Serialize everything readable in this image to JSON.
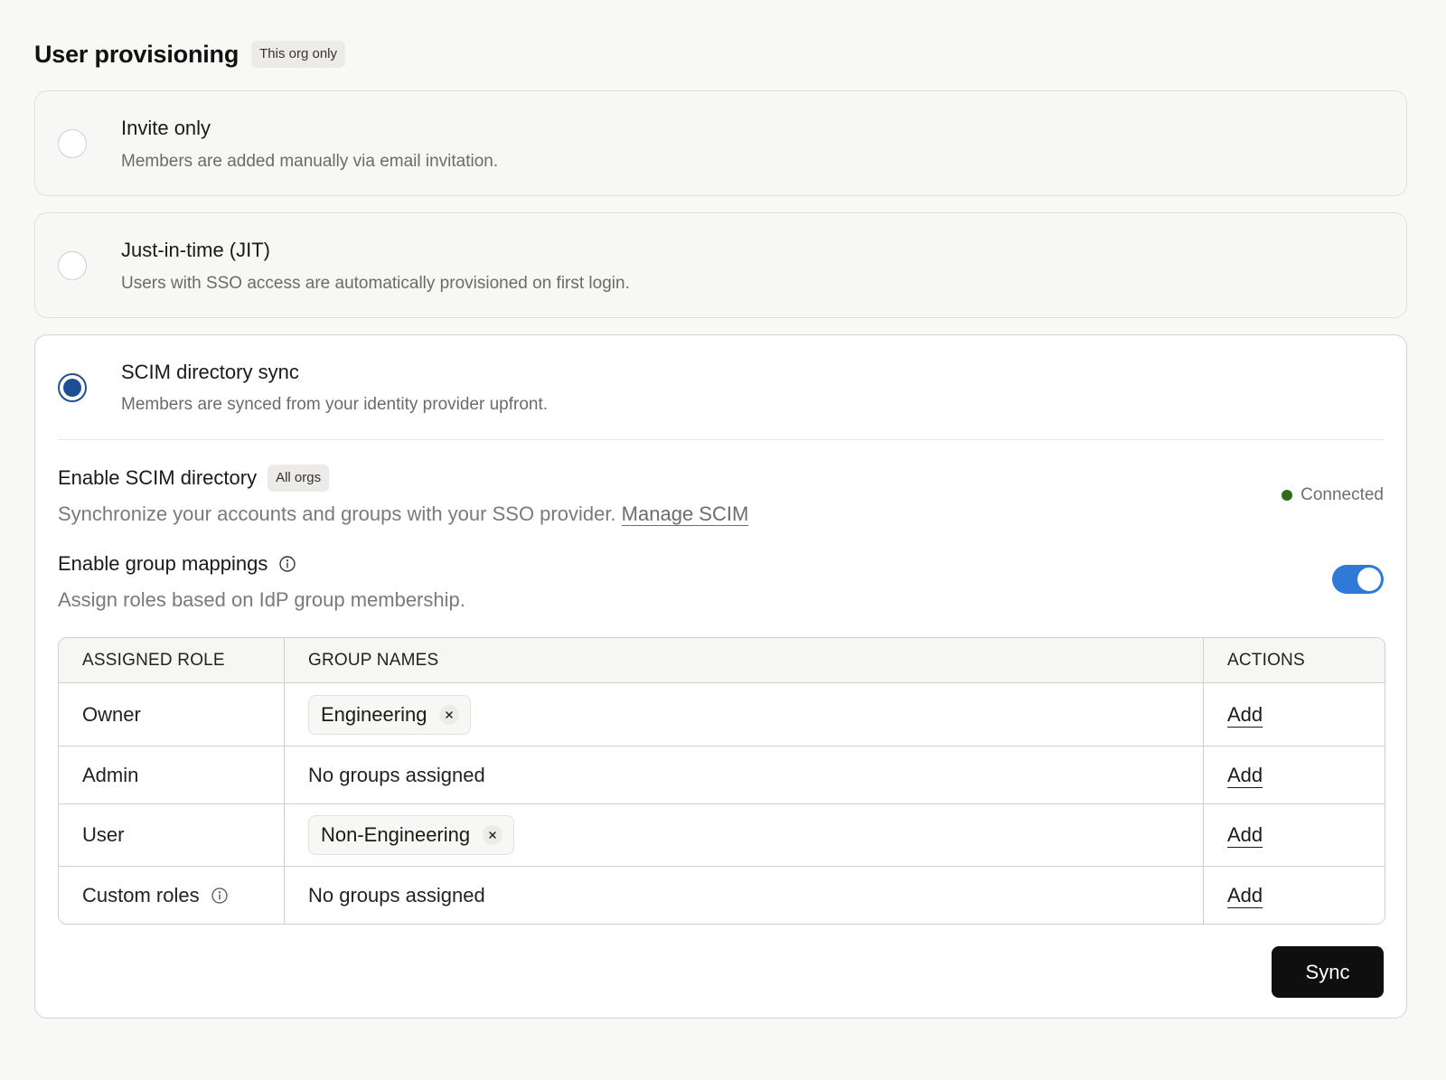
{
  "header": {
    "title": "User provisioning",
    "badge": "This org only"
  },
  "options": [
    {
      "title": "Invite only",
      "description": "Members are added manually via email invitation.",
      "selected": false
    },
    {
      "title": "Just-in-time (JIT)",
      "description": "Users with SSO access are automatically provisioned on first login.",
      "selected": false
    },
    {
      "title": "SCIM directory sync",
      "description": "Members are synced from your identity provider upfront.",
      "selected": true
    }
  ],
  "scim": {
    "title": "Enable SCIM directory",
    "badge": "All orgs",
    "description": "Synchronize your accounts and groups with your SSO provider.",
    "manage_link": "Manage SCIM",
    "status": "Connected",
    "status_color": "#2e6b1a"
  },
  "group_mappings": {
    "title": "Enable group mappings",
    "description": "Assign roles based on IdP group membership.",
    "enabled": true,
    "toggle_color": "#2f7ad6"
  },
  "table": {
    "headers": {
      "role": "ASSIGNED ROLE",
      "groups": "GROUP NAMES",
      "actions": "ACTIONS"
    },
    "rows": [
      {
        "role": "Owner",
        "group": "Engineering",
        "empty_text": "",
        "action": "Add"
      },
      {
        "role": "Admin",
        "group": "",
        "empty_text": "No groups assigned",
        "action": "Add"
      },
      {
        "role": "User",
        "group": "Non-Engineering",
        "empty_text": "",
        "action": "Add"
      },
      {
        "role": "Custom roles",
        "group": "",
        "empty_text": "No groups assigned",
        "action": "Add"
      }
    ]
  },
  "sync_button": "Sync",
  "colors": {
    "accent": "#1d4f94",
    "primary_button": "#0f0f0f"
  },
  "icons": {
    "info": "info-icon",
    "remove": "close-icon"
  }
}
